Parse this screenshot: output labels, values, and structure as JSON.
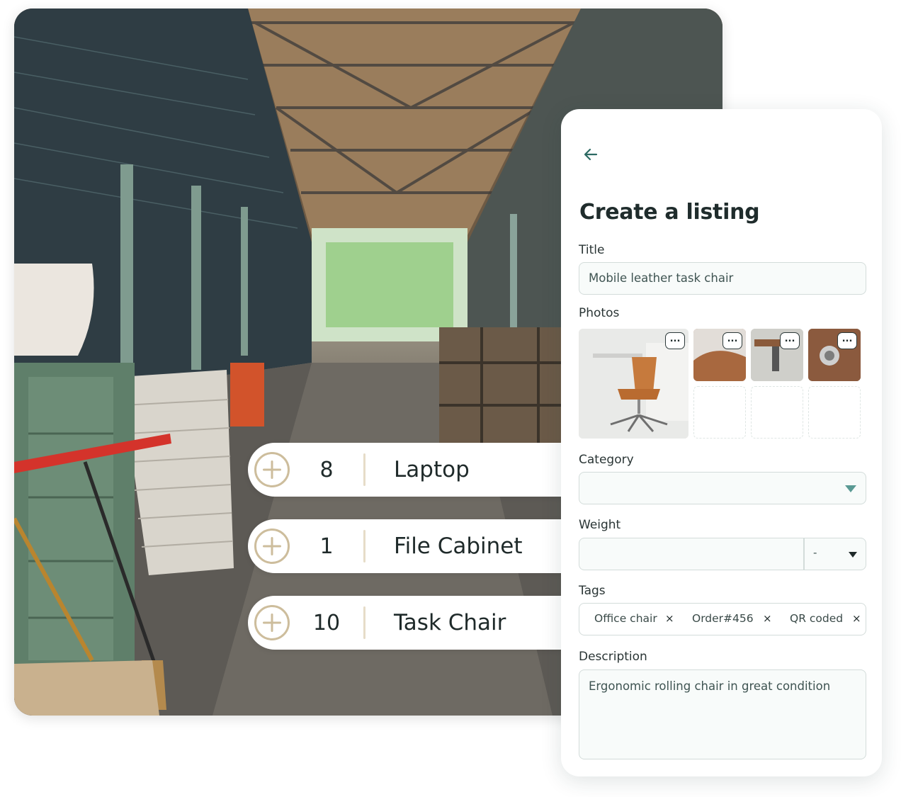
{
  "colors": {
    "accent": "#2d6a63",
    "caret": "#5a9a94",
    "plus_gold": "#cdbd9c",
    "field_border": "#d3dcda"
  },
  "inventory": [
    {
      "qty": "8",
      "name": "Laptop"
    },
    {
      "qty": "1",
      "name": "File Cabinet"
    },
    {
      "qty": "10",
      "name": "Task Chair"
    }
  ],
  "listing": {
    "back_icon": "arrow-left-icon",
    "heading": "Create a listing",
    "title_label": "Title",
    "title_value": "Mobile leather task chair",
    "photos_label": "Photos",
    "photo_more": "...",
    "category_label": "Category",
    "category_value": "",
    "weight_label": "Weight",
    "weight_value": "",
    "weight_unit": "-",
    "tags_label": "Tags",
    "tags": [
      "Office chair",
      "Order#456",
      "QR coded"
    ],
    "tag_remove": "×",
    "description_label": "Description",
    "description_value": "Ergonomic rolling chair in great condition"
  }
}
